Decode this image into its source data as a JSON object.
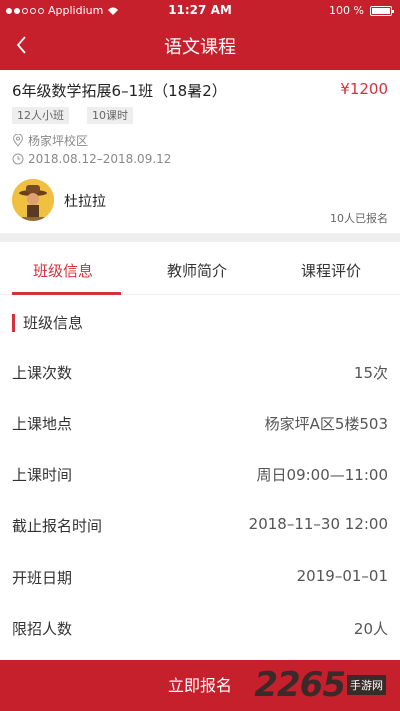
{
  "status_bar": {
    "carrier": "Applidium",
    "time": "11:27 AM",
    "battery": "100 %"
  },
  "nav": {
    "title": "语文课程"
  },
  "course": {
    "title": "6年级数学拓展6–1班（18暑2）",
    "price": "¥1200",
    "tags": [
      "12人小班",
      "10课时"
    ],
    "campus": "杨家坪校区",
    "date_range": "2018.08.12–2018.09.12",
    "teacher": "杜拉拉",
    "enrolled": "10人已报名"
  },
  "tabs": [
    "班级信息",
    "教师简介",
    "课程评价"
  ],
  "section": {
    "title": "班级信息"
  },
  "info_rows": [
    {
      "label": "上课次数",
      "value": "15次"
    },
    {
      "label": "上课地点",
      "value": "杨家坪A区5楼503"
    },
    {
      "label": "上课时间",
      "value": "周日09:00—11:00"
    },
    {
      "label": "截止报名时间",
      "value": "2018–11–30 12:00"
    },
    {
      "label": "开班日期",
      "value": "2019–01–01"
    },
    {
      "label": "限招人数",
      "value": "20人"
    }
  ],
  "footer": {
    "button": "立即报名"
  },
  "watermark": {
    "number": "2265",
    "sub": "手游网"
  },
  "colors": {
    "brand": "#c5202c",
    "accent": "#d6303c"
  }
}
